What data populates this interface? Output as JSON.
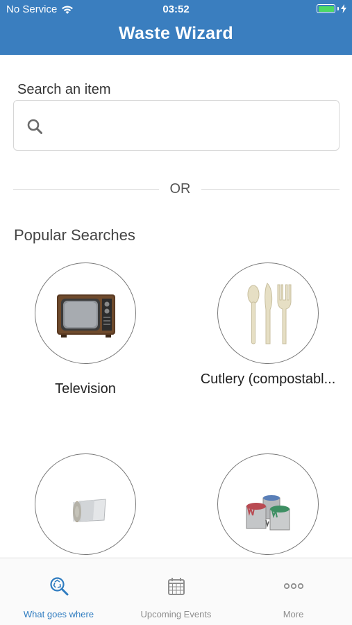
{
  "status_bar": {
    "carrier": "No Service",
    "time": "03:52"
  },
  "header": {
    "title": "Waste Wizard"
  },
  "search": {
    "label": "Search an item",
    "value": "",
    "placeholder": ""
  },
  "divider": {
    "text": "OR"
  },
  "popular": {
    "title": "Popular Searches",
    "items": [
      {
        "label": "Television",
        "icon": "television-icon"
      },
      {
        "label": "Cutlery (compostabl...",
        "icon": "cutlery-icon"
      },
      {
        "label": "",
        "icon": "foil-roll-icon"
      },
      {
        "label": "",
        "icon": "paint-cans-icon"
      }
    ]
  },
  "tabbar": {
    "tabs": [
      {
        "label": "What goes where",
        "icon": "recycle-search-icon",
        "active": true
      },
      {
        "label": "Upcoming Events",
        "icon": "calendar-icon",
        "active": false
      },
      {
        "label": "More",
        "icon": "more-dots-icon",
        "active": false
      }
    ]
  },
  "colors": {
    "header": "#3a7ebf",
    "active_tab": "#2f7cc0",
    "inactive_tab": "#8e8e8e",
    "battery": "#4cd964"
  }
}
